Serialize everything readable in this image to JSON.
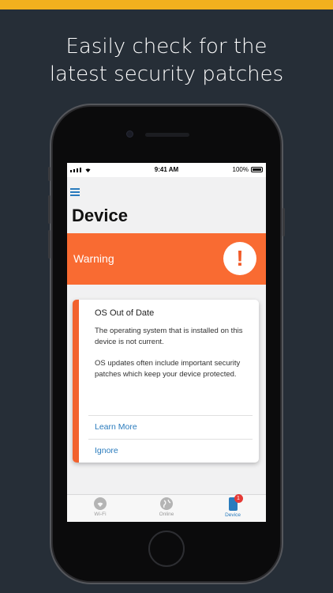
{
  "headline": {
    "line1": "Easily check for the",
    "line2": "latest security patches"
  },
  "status_bar": {
    "time": "9:41 AM",
    "battery": "100%"
  },
  "page": {
    "title": "Device"
  },
  "warning": {
    "label": "Warning",
    "icon": "exclamation-icon",
    "icon_glyph": "!"
  },
  "card": {
    "title": "OS Out of Date",
    "paragraph1": "The operating system that is installed on this device is not current.",
    "paragraph2": "OS updates often include important security patches which keep your device protected.",
    "learn_more": "Learn More",
    "ignore": "Ignore"
  },
  "tabs": [
    {
      "label": "Wi-Fi",
      "icon": "wifi-icon"
    },
    {
      "label": "Online",
      "icon": "globe-icon"
    },
    {
      "label": "Device",
      "icon": "phone-icon",
      "badge": "1",
      "active": true
    }
  ],
  "colors": {
    "accent_bar": "#f2b01e",
    "warning": "#f96b32",
    "link": "#2a7bbd",
    "background": "#262e37"
  }
}
